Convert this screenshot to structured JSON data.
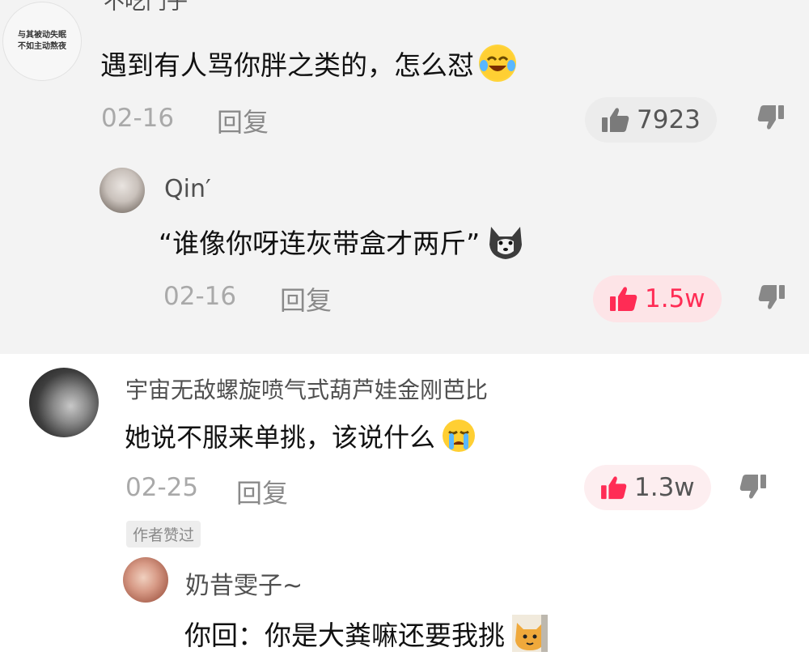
{
  "comments": [
    {
      "avatar_text": [
        "与其被动失眠",
        "不如主动熬夜"
      ],
      "username": "不吃门子",
      "text": "遇到有人骂你胖之类的，怎么怼",
      "emoji": "laughing-crying-emoji-icon",
      "date": "02-16",
      "reply_label": "回复",
      "likes": "7923",
      "liked": false,
      "replies": [
        {
          "username": "Qin′",
          "text": "“谁像你呀连灰带盒才两斤”",
          "emoji": "husky-dog-emoji-icon",
          "date": "02-16",
          "reply_label": "回复",
          "likes": "1.5w",
          "liked": true
        }
      ]
    },
    {
      "username": "宇宙无敌螺旋喷气式葫芦娃金刚芭比",
      "text": "她说不服来单挑，该说什么",
      "emoji": "crying-emoji-icon",
      "date": "02-25",
      "reply_label": "回复",
      "likes": "1.3w",
      "liked": true,
      "author_tag": "作者赞过",
      "replies": [
        {
          "username": "奶昔雯子~",
          "text": "你回：你是大粪嘛还要我挑",
          "emoji": "cat-emoji-icon"
        }
      ]
    }
  ],
  "colors": {
    "like_red": "#ff2c55",
    "like_bg_red": "#fde4e7",
    "like_bg_gray": "#ececec",
    "gray_band": "#f3f3f3"
  }
}
